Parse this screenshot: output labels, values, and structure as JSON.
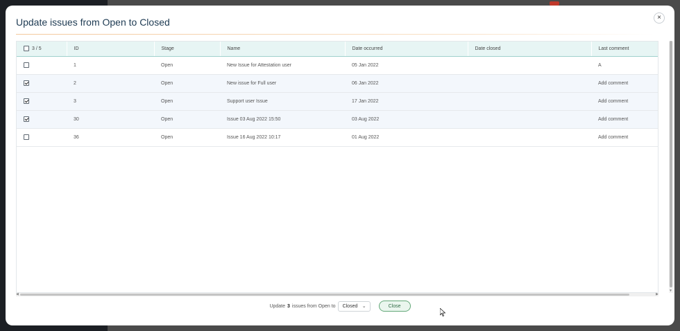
{
  "modal": {
    "title": "Update issues from Open to Closed",
    "close_icon": "×"
  },
  "table": {
    "selection_count": "3 / 5",
    "columns": [
      "ID",
      "Stage",
      "Name",
      "Date occurred",
      "Date closed",
      "Last comment"
    ],
    "rows": [
      {
        "checked": false,
        "id": "1",
        "stage": "Open",
        "name": "New Issue for Attestation user",
        "date_occurred": "05 Jan 2022",
        "date_closed": "",
        "last_comment": "A"
      },
      {
        "checked": true,
        "id": "2",
        "stage": "Open",
        "name": "New issue for Full user",
        "date_occurred": "06 Jan 2022",
        "date_closed": "",
        "last_comment": "Add comment"
      },
      {
        "checked": true,
        "id": "3",
        "stage": "Open",
        "name": "Support user Issue",
        "date_occurred": "17 Jan 2022",
        "date_closed": "",
        "last_comment": "Add comment"
      },
      {
        "checked": true,
        "id": "30",
        "stage": "Open",
        "name": "Issue 03 Aug 2022 15:50",
        "date_occurred": "03 Aug 2022",
        "date_closed": "",
        "last_comment": "Add comment"
      },
      {
        "checked": false,
        "id": "36",
        "stage": "Open",
        "name": "Issue 16 Aug 2022 10:17",
        "date_occurred": "01 Aug 2022",
        "date_closed": "",
        "last_comment": "Add comment"
      }
    ]
  },
  "footer": {
    "prefix": "Update",
    "count": "3",
    "middle": "issues from Open to",
    "target_stage": "Closed",
    "close_label": "Close"
  },
  "colors": {
    "title": "#1d3a52",
    "header_bg": "#e7f5f4",
    "accent_line": "#f3c89c",
    "close_button_border": "#62a777"
  }
}
